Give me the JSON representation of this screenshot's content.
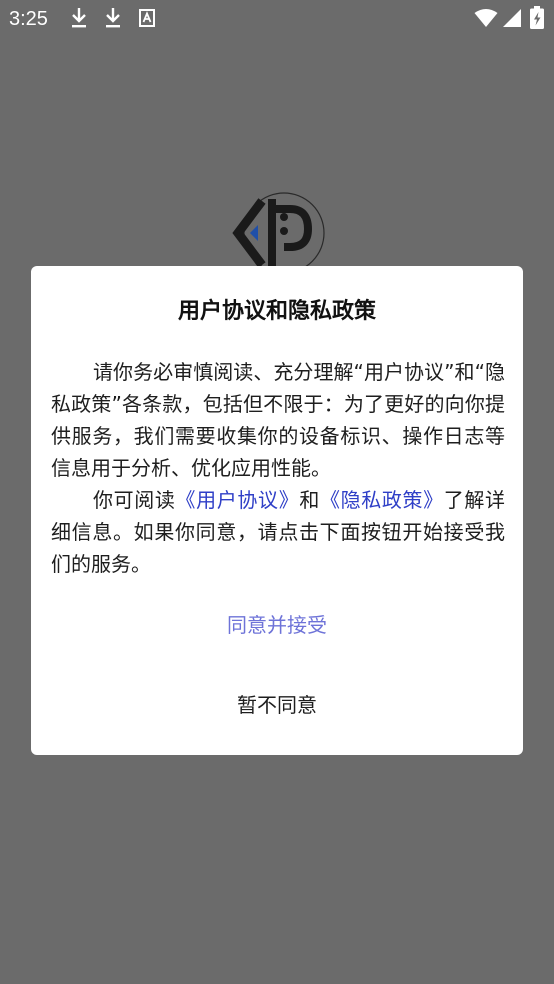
{
  "status_bar": {
    "time": "3:25",
    "icons": [
      "download-icon",
      "download-icon",
      "text-notification-icon",
      "wifi-icon",
      "cellular-signal-icon",
      "battery-icon"
    ]
  },
  "dialog": {
    "title": "用户协议和隐私政策",
    "paragraph1": "请你务必审慎阅读、充分理解“用户协议”和“隐私政策”各条款，包括但不限于：为了更好的向你提供服务，我们需要收集你的设备标识、操作日志等信息用于分析、优化应用性能。",
    "paragraph2_prefix": "你可阅读",
    "user_agreement_link": "《用户协议》",
    "conjunction": "和",
    "privacy_policy_link": "《隐私政策》",
    "paragraph2_suffix": "了解详细信息。如果你同意，请点击下面按钮开始接受我们的服务。",
    "agree_button": "同意并接受",
    "disagree_button": "暂不同意"
  },
  "colors": {
    "overlay": "#6b6b6b",
    "link": "#2f3fc7",
    "agree": "#6e73d8",
    "logo_blue": "#1f4fa8"
  }
}
